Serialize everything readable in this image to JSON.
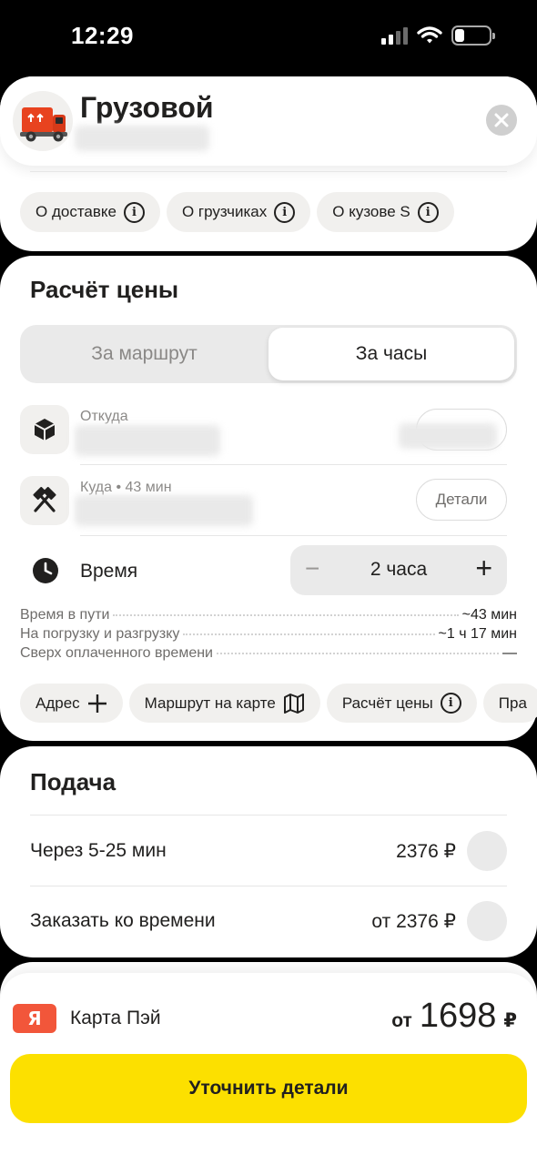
{
  "status_bar": {
    "time": "12:29"
  },
  "header": {
    "title": "Грузовой",
    "chips": [
      {
        "label": "О доставке",
        "icon": "info-icon"
      },
      {
        "label": "О грузчиках",
        "icon": "info-icon"
      },
      {
        "label": "О кузове S",
        "icon": "info-icon"
      }
    ]
  },
  "price_calc": {
    "title": "Расчёт цены",
    "tabs": [
      "За маршрут",
      "За часы"
    ],
    "active_tab": "За часы",
    "from": {
      "label": "Откуда",
      "icon": "box-icon"
    },
    "to": {
      "label": "Куда • 43 мин",
      "icon": "hammers-icon",
      "details_button": "Детали"
    },
    "time": {
      "label": "Время",
      "icon": "clock-icon",
      "value": "2 часа",
      "minus": "−",
      "plus": "+"
    },
    "breakdown": [
      {
        "label": "Время в пути",
        "value": "~43 мин"
      },
      {
        "label": "На погрузку и разгрузку",
        "value": "~1 ч 17 мин"
      },
      {
        "label": "Сверх оплаченного времени",
        "value": "—"
      }
    ],
    "chips": [
      {
        "label": "Адрес",
        "icon": "plus-icon"
      },
      {
        "label": "Маршрут на карте",
        "icon": "map-icon"
      },
      {
        "label": "Расчёт цены",
        "icon": "info-icon"
      },
      {
        "label": "Пра"
      }
    ]
  },
  "delivery": {
    "title": "Подача",
    "options": [
      {
        "label": "Через 5-25 мин",
        "price": "2376 ₽"
      },
      {
        "label": "Заказать ко времени",
        "price": "от 2376 ₽"
      }
    ]
  },
  "payment": {
    "badge": "Я",
    "method": "Карта Пэй",
    "price_prefix": "от",
    "price": "1698",
    "currency": "₽",
    "badge_color": "#f2563a"
  },
  "cta": {
    "label": "Уточнить детали",
    "color": "#fce000"
  }
}
